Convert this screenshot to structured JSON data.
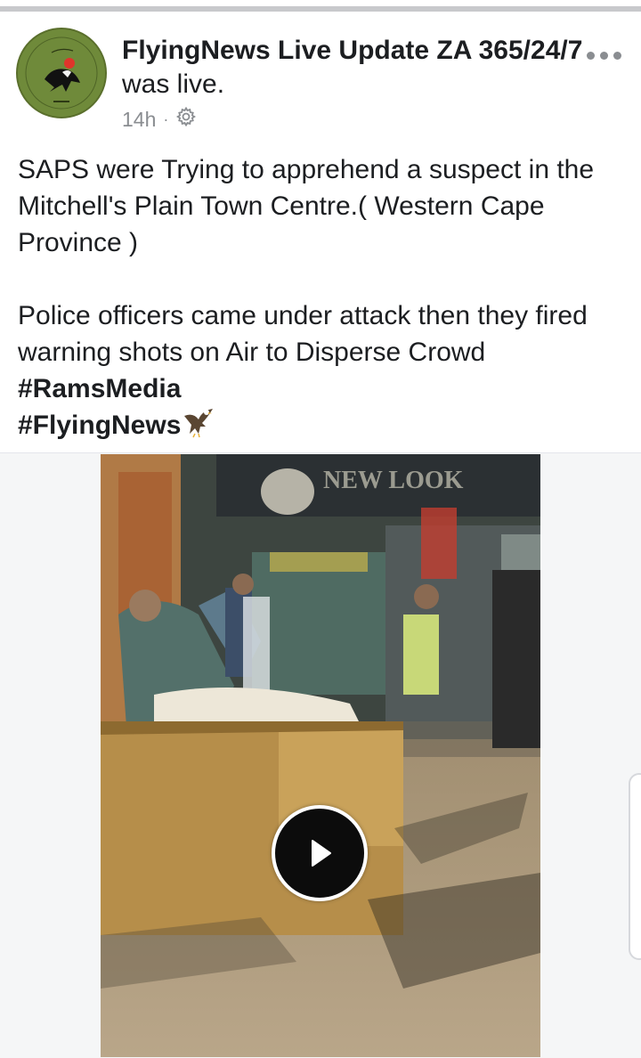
{
  "post": {
    "author": "FlyingNews Live Update ZA 365/24/7",
    "author_suffix": "was live.",
    "timestamp": "14h",
    "separator": "·",
    "privacy_icon": "gear-icon",
    "more_icon": "more-horizontal-icon",
    "text_lines": [
      "SAPS were Trying to apprehend a suspect in the Mitchell's Plain Town Centre.( Western Cape Province )",
      "Police officers came under attack then they fired warning shots on Air to Disperse Crowd"
    ],
    "hashtags": [
      "#RamsMedia",
      "#FlyingNews"
    ],
    "emoji": "eagle-icon"
  },
  "video": {
    "play_icon": "play-icon",
    "sign_text": "NEW LOOK"
  },
  "colors": {
    "avatar_green": "#6f8a3a",
    "text": "#1c1e21",
    "meta": "#8a8d91"
  }
}
